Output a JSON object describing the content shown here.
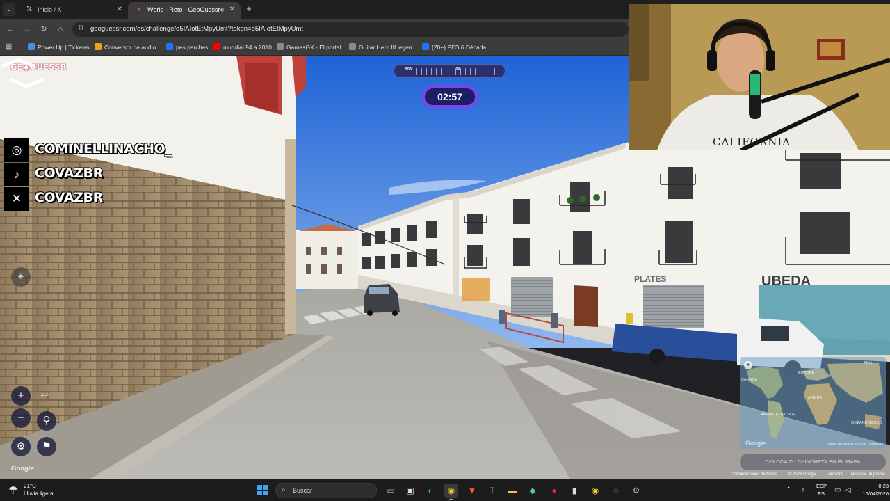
{
  "browser": {
    "tabs": [
      {
        "title": "Inicio / X",
        "icon": "x-logo-icon"
      },
      {
        "title": "World - Reto - GeoGuessr",
        "icon": "geoguessr-pin-icon",
        "audio": true
      }
    ],
    "url": "geoguessr.com/es/challenge/o5IAIotEtMpyUmt?token=o5IAIotEtMpyUmt",
    "bookmarks": [
      {
        "label": "Power Up | Ticketek",
        "color": "#4a90e2"
      },
      {
        "label": "Conversor de audio...",
        "color": "#f0a020"
      },
      {
        "label": "pes parches",
        "color": "#1877f2"
      },
      {
        "label": "mundial 94 a 2010",
        "color": "#ff0000"
      },
      {
        "label": "GamesGX - El portal...",
        "color": "#8a8a8a"
      },
      {
        "label": "Guitar Hero III legen...",
        "color": "#8a8a8a"
      },
      {
        "label": "(20+) PES 6 Década...",
        "color": "#1877f2"
      }
    ]
  },
  "game": {
    "logo": "GE◉GUESSR",
    "compass": {
      "left": "NW",
      "center": "N"
    },
    "timer": "02:57",
    "social": [
      {
        "icon": "instagram-icon",
        "glyph": "◎",
        "handle": "COMINELLINACHO_"
      },
      {
        "icon": "tiktok-icon",
        "glyph": "♪",
        "handle": "COVAZBR"
      },
      {
        "icon": "x-logo-icon",
        "glyph": "✕",
        "handle": "COVAZBR"
      }
    ],
    "google_mark": "Google",
    "minimap": {
      "labels": [
        "ASIA",
        "EUROPE",
        "AFRICA",
        "AMÉRICA DEL SUR",
        "OCÉANO ÍNDICO",
        "CANADÁ"
      ],
      "google": "Google",
      "attribution": "Datos del mapa ©2026   Términos",
      "place_pin": "COLOCA TU CHINCHETA EN EL MAPA"
    },
    "maps_footer": [
      "Combinaciones de teclas",
      "© 2026 Google",
      "Términos",
      "Notificar un proble"
    ]
  },
  "scene_text": {
    "shop_sign": "UBEDA",
    "shop_sign2": "PLATES"
  },
  "taskbar": {
    "weather_temp": "21°C",
    "weather_cond": "Lluvia ligera",
    "search_placeholder": "Buscar",
    "lang1": "ESP",
    "lang2": "ES",
    "time": "0:23",
    "date": "16/04/2026"
  }
}
